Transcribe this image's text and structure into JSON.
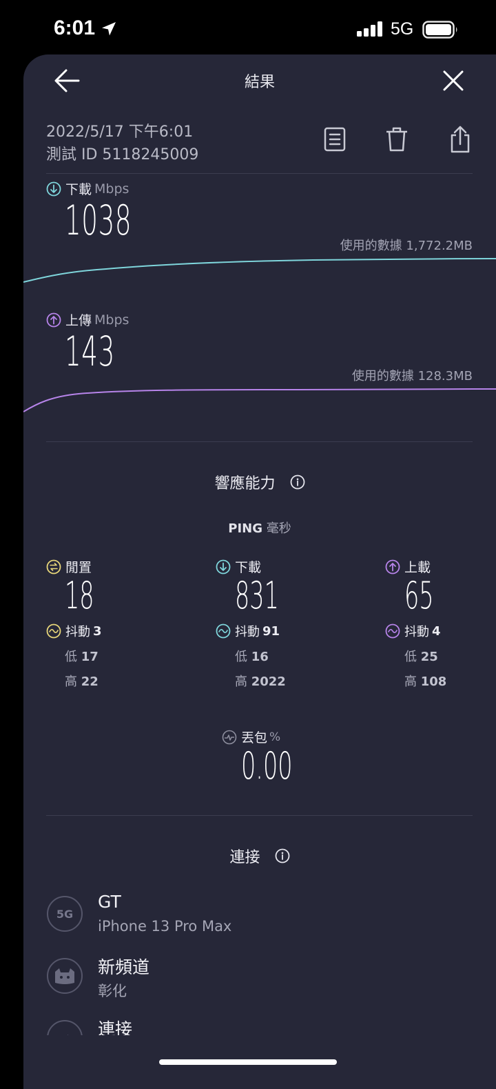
{
  "status_bar": {
    "time": "6:01",
    "network": "5G"
  },
  "nav": {
    "title": "結果"
  },
  "meta": {
    "datetime": "2022/5/17 下午6:01",
    "test_id": "測試 ID 5118245009"
  },
  "download": {
    "label": "下載",
    "unit": "Mbps",
    "value": "1038",
    "data_used": "使用的數據 1,772.2MB"
  },
  "upload": {
    "label": "上傳",
    "unit": "Mbps",
    "value": "143",
    "data_used": "使用的數據 128.3MB"
  },
  "responsiveness": {
    "title": "響應能力",
    "ping_label": "PING",
    "ping_unit": "毫秒",
    "columns": [
      {
        "label": "閒置",
        "value": "18",
        "jitter_label": "抖動",
        "jitter": "3",
        "low_label": "低",
        "low": "17",
        "high_label": "高",
        "high": "22"
      },
      {
        "label": "下載",
        "value": "831",
        "jitter_label": "抖動",
        "jitter": "91",
        "low_label": "低",
        "low": "16",
        "high_label": "高",
        "high": "2022"
      },
      {
        "label": "上載",
        "value": "65",
        "jitter_label": "抖動",
        "jitter": "4",
        "low_label": "低",
        "low": "25",
        "high_label": "高",
        "high": "108"
      }
    ],
    "packet_loss": {
      "label": "丟包",
      "unit": "%",
      "value": "0.00"
    }
  },
  "connection": {
    "title": "連接",
    "items": [
      {
        "badge": "5G",
        "name": "GT",
        "sub": "iPhone 13 Pro Max"
      },
      {
        "name": "新頻道",
        "sub": "彰化"
      },
      {
        "name": "連接"
      }
    ]
  },
  "colors": {
    "download_accent": "#7fd6dc",
    "upload_accent": "#b784ea",
    "idle_accent": "#e8d77a",
    "sheet_bg": "#262738"
  }
}
